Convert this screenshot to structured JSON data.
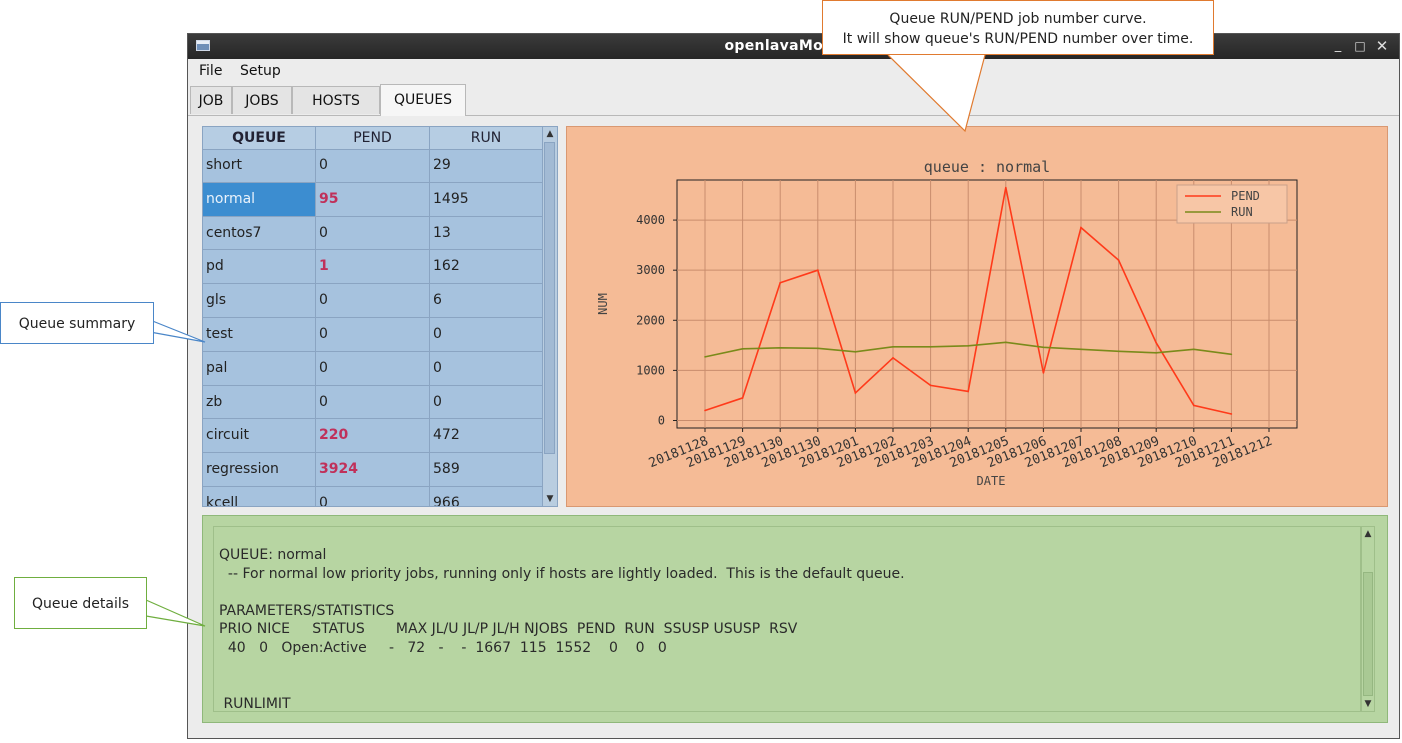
{
  "window": {
    "title": "openlavaMonitor",
    "controls": {
      "minimize": "_",
      "maximize": "□",
      "close": "✕"
    }
  },
  "menu": [
    "File",
    "Setup"
  ],
  "tabs": [
    {
      "label": "JOB",
      "active": false
    },
    {
      "label": "JOBS",
      "active": false
    },
    {
      "label": "HOSTS",
      "active": false
    },
    {
      "label": "QUEUES",
      "active": true
    }
  ],
  "queue_table": {
    "columns": [
      "QUEUE",
      "PEND",
      "RUN"
    ],
    "selected": "normal",
    "rows": [
      {
        "queue": "short",
        "pend": "0",
        "run": "29"
      },
      {
        "queue": "normal",
        "pend": "95",
        "run": "1495"
      },
      {
        "queue": "centos7",
        "pend": "0",
        "run": "13"
      },
      {
        "queue": "pd",
        "pend": "1",
        "run": "162"
      },
      {
        "queue": "gls",
        "pend": "0",
        "run": "6"
      },
      {
        "queue": "test",
        "pend": "0",
        "run": "0"
      },
      {
        "queue": "pal",
        "pend": "0",
        "run": "0"
      },
      {
        "queue": "zb",
        "pend": "0",
        "run": "0"
      },
      {
        "queue": "circuit",
        "pend": "220",
        "run": "472"
      },
      {
        "queue": "regression",
        "pend": "3924",
        "run": "589"
      },
      {
        "queue": "kcell",
        "pend": "0",
        "run": "966"
      }
    ]
  },
  "chart_data": {
    "type": "line",
    "title": "queue : normal",
    "xlabel": "DATE",
    "ylabel": "NUM",
    "categories": [
      "20181128",
      "20181129",
      "20181130",
      "20181130",
      "20181201",
      "20181202",
      "20181203",
      "20181204",
      "20181205",
      "20181206",
      "20181207",
      "20181208",
      "20181209",
      "20181210",
      "20181211",
      "20181212"
    ],
    "ylim": [
      -150,
      4800
    ],
    "yticks": [
      0,
      1000,
      2000,
      3000,
      4000
    ],
    "grid": true,
    "legend": "top-right",
    "series": [
      {
        "name": "PEND",
        "color": "#ff3a1a",
        "values": [
          200,
          450,
          2750,
          3000,
          550,
          1250,
          700,
          580,
          4650,
          950,
          3850,
          3200,
          1550,
          300,
          130
        ]
      },
      {
        "name": "RUN",
        "color": "#7a8a1a",
        "values": [
          1270,
          1430,
          1450,
          1440,
          1370,
          1470,
          1470,
          1490,
          1560,
          1460,
          1420,
          1380,
          1350,
          1420,
          1320
        ]
      }
    ],
    "background": "#f5bb96"
  },
  "details": {
    "lines": [
      "QUEUE: normal",
      "  -- For normal low priority jobs, running only if hosts are lightly loaded.  This is the default queue.",
      "",
      "PARAMETERS/STATISTICS",
      "PRIO NICE     STATUS       MAX JL/U JL/P JL/H NJOBS  PEND  RUN  SSUSP USUSP  RSV",
      "  40   0   Open:Active     -   72   -    -  1667  115  1552    0    0   0",
      "",
      "",
      " RUNLIMIT"
    ]
  },
  "callouts": {
    "chart": [
      "Queue RUN/PEND job number curve.",
      "It will show queue's RUN/PEND number over time."
    ],
    "summary": "Queue summary",
    "details": "Queue details"
  },
  "colors": {
    "table_bg": "#a6c2de",
    "selected_row": "#3c8dd0",
    "hot_value": "#c0305a",
    "chart_bg": "#f5bb96",
    "details_bg": "#b7d5a2",
    "callout_chart_border": "#e07a2f",
    "callout_summary_border": "#4a86c8",
    "callout_details_border": "#6fae3f"
  }
}
